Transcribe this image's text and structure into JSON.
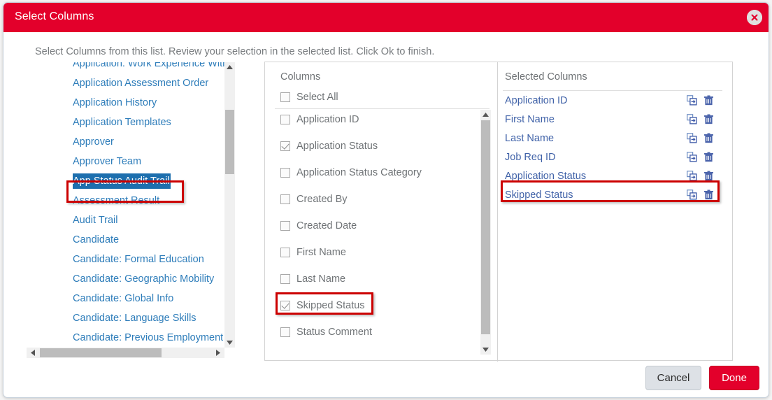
{
  "dialog": {
    "title": "Select Columns",
    "description": "Select Columns from this list. Review your selection in the selected list. Click Ok to finish.",
    "close_icon": "close-icon",
    "accent_color": "#e3002b",
    "link_color": "#2e7dba",
    "selection_color": "#1d6fae",
    "annotation_color": "#cc0000"
  },
  "categories": {
    "items": [
      {
        "label": "Application: Work Experience With",
        "selected": false
      },
      {
        "label": "Application Assessment Order",
        "selected": false
      },
      {
        "label": "Application History",
        "selected": false
      },
      {
        "label": "Application Templates",
        "selected": false
      },
      {
        "label": "Approver",
        "selected": false
      },
      {
        "label": "Approver Team",
        "selected": false
      },
      {
        "label": "App Status Audit Trail",
        "selected": true
      },
      {
        "label": "Assessment Result",
        "selected": false
      },
      {
        "label": "Audit Trail",
        "selected": false
      },
      {
        "label": "Candidate",
        "selected": false
      },
      {
        "label": "Candidate: Formal Education",
        "selected": false
      },
      {
        "label": "Candidate: Geographic Mobility",
        "selected": false
      },
      {
        "label": "Candidate: Global Info",
        "selected": false
      },
      {
        "label": "Candidate: Language Skills",
        "selected": false
      },
      {
        "label": "Candidate: Previous Employment",
        "selected": false
      }
    ],
    "scroll_up_icon": "scroll-up-arrow-icon",
    "scroll_down_icon": "scroll-down-arrow-icon",
    "scroll_left_icon": "scroll-left-arrow-icon",
    "scroll_right_icon": "scroll-right-arrow-icon"
  },
  "columns": {
    "header": "Columns",
    "select_all": {
      "label": "Select All",
      "checked": false
    },
    "items": [
      {
        "label": "Application ID",
        "checked": false
      },
      {
        "label": "Application Status",
        "checked": true
      },
      {
        "label": "Application Status Category",
        "checked": false
      },
      {
        "label": "Created By",
        "checked": false
      },
      {
        "label": "Created Date",
        "checked": false
      },
      {
        "label": "First Name",
        "checked": false
      },
      {
        "label": "Last Name",
        "checked": false
      },
      {
        "label": "Skipped Status",
        "checked": true
      },
      {
        "label": "Status Comment",
        "checked": false
      }
    ]
  },
  "selected_columns": {
    "header": "Selected Columns",
    "items": [
      {
        "label": "Application ID"
      },
      {
        "label": "First Name"
      },
      {
        "label": "Last Name"
      },
      {
        "label": "Job Req ID"
      },
      {
        "label": "Application Status"
      },
      {
        "label": "Skipped Status"
      }
    ],
    "move_icon": "move-column-icon",
    "delete_icon": "trash-icon"
  },
  "footer": {
    "cancel_label": "Cancel",
    "done_label": "Done"
  }
}
